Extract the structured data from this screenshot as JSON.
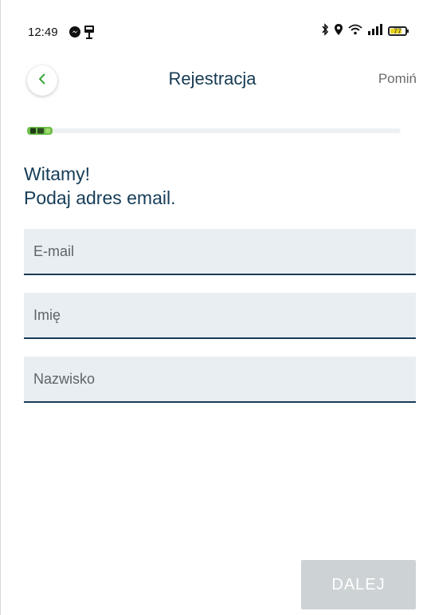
{
  "status_bar": {
    "time": "12:49",
    "battery_level": "77",
    "battery_fraction": 0.77,
    "left_icons": [
      "messenger-icon",
      "parking-meter-icon"
    ],
    "right_icons": [
      "bluetooth-icon",
      "location-icon",
      "wifi-icon",
      "signal-icon",
      "battery-icon"
    ]
  },
  "header": {
    "title": "Rejestracja",
    "skip_label": "Pomiń",
    "back_icon": "chevron-left-icon"
  },
  "progress": {
    "value": 0.02,
    "icon": "car-icon"
  },
  "welcome": {
    "line1": "Witamy!",
    "line2": "Podaj adres email."
  },
  "form": {
    "email_placeholder": "E-mail",
    "email_value": "",
    "first_name_placeholder": "Imię",
    "first_name_value": "",
    "last_name_placeholder": "Nazwisko",
    "last_name_value": ""
  },
  "actions": {
    "next_label": "DALEJ"
  },
  "colors": {
    "accent_green": "#3aa63a",
    "title_navy": "#153a52",
    "field_bg": "#e8eef1",
    "field_underline": "#1a3a56",
    "button_disabled": "#cdd2d5"
  }
}
